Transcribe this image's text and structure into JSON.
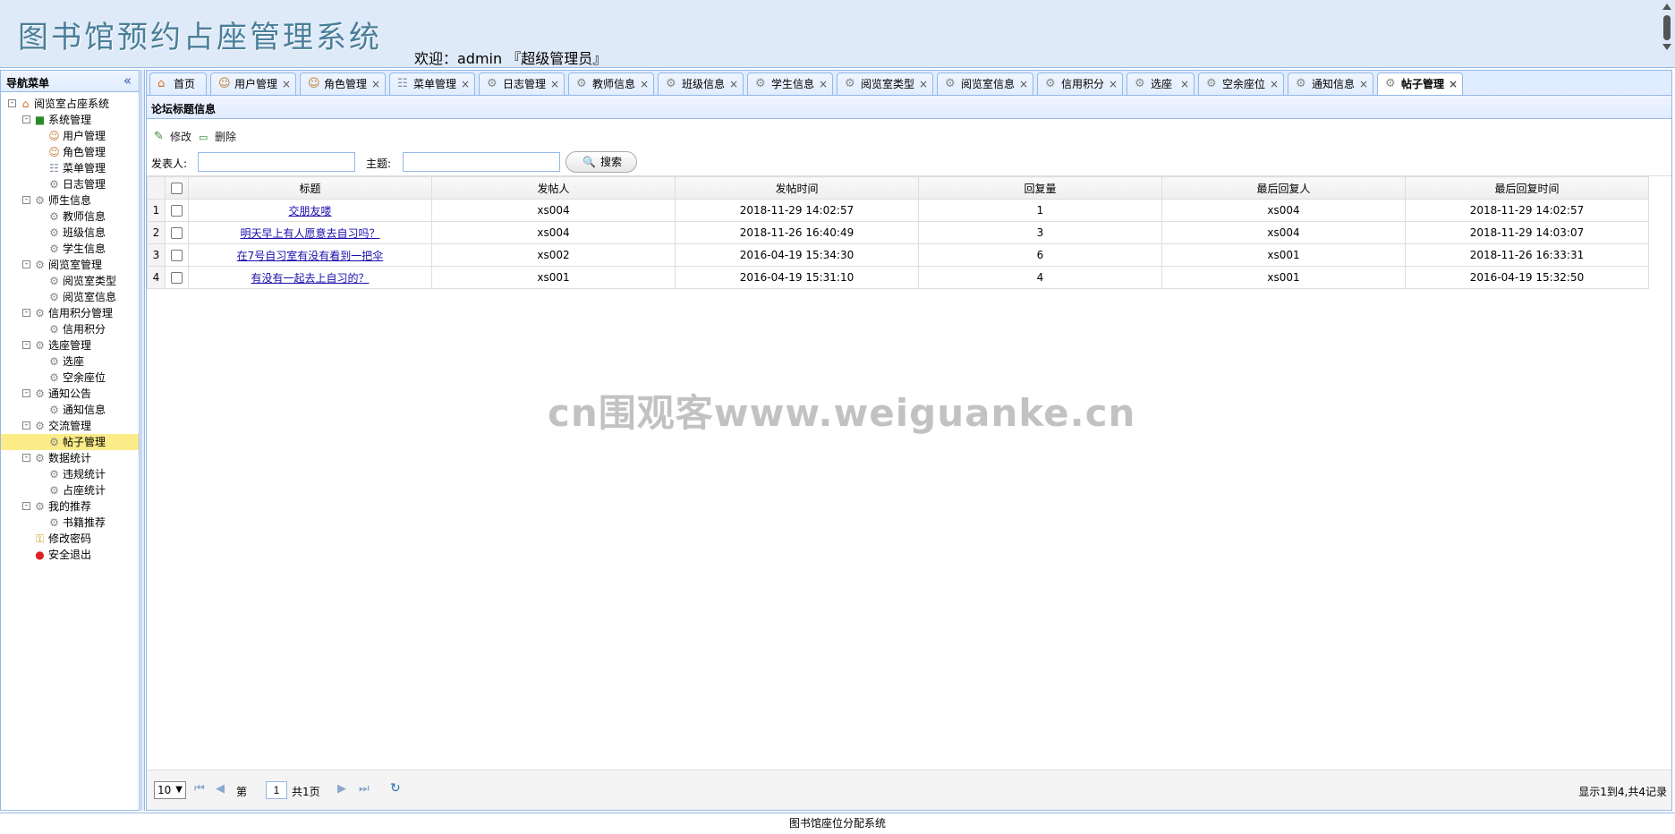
{
  "header": {
    "app_title": "图书馆预约占座管理系统",
    "welcome": "欢迎：admin 『超级管理员』"
  },
  "nav": {
    "title": "导航菜单",
    "collapse_icon": "double-chevron-left-icon",
    "tree": [
      {
        "label": "阅览室占座系统",
        "level": 0,
        "icon": "home-icon",
        "toggle": "-"
      },
      {
        "label": "系统管理",
        "level": 1,
        "icon": "system-icon",
        "toggle": "-"
      },
      {
        "label": "用户管理",
        "level": 2,
        "icon": "user-icon"
      },
      {
        "label": "角色管理",
        "level": 2,
        "icon": "user-icon"
      },
      {
        "label": "菜单管理",
        "level": 2,
        "icon": "menu-icon"
      },
      {
        "label": "日志管理",
        "level": 2,
        "icon": "gear-icon"
      },
      {
        "label": "师生信息",
        "level": 1,
        "icon": "gear-icon",
        "toggle": "-"
      },
      {
        "label": "教师信息",
        "level": 2,
        "icon": "gear-icon"
      },
      {
        "label": "班级信息",
        "level": 2,
        "icon": "gear-icon"
      },
      {
        "label": "学生信息",
        "level": 2,
        "icon": "gear-icon"
      },
      {
        "label": "阅览室管理",
        "level": 1,
        "icon": "gear-icon",
        "toggle": "-"
      },
      {
        "label": "阅览室类型",
        "level": 2,
        "icon": "gear-icon"
      },
      {
        "label": "阅览室信息",
        "level": 2,
        "icon": "gear-icon"
      },
      {
        "label": "信用积分管理",
        "level": 1,
        "icon": "gear-icon",
        "toggle": "-"
      },
      {
        "label": "信用积分",
        "level": 2,
        "icon": "gear-icon"
      },
      {
        "label": "选座管理",
        "level": 1,
        "icon": "gear-icon",
        "toggle": "-"
      },
      {
        "label": "选座",
        "level": 2,
        "icon": "gear-icon"
      },
      {
        "label": "空余座位",
        "level": 2,
        "icon": "gear-icon"
      },
      {
        "label": "通知公告",
        "level": 1,
        "icon": "gear-icon",
        "toggle": "-"
      },
      {
        "label": "通知信息",
        "level": 2,
        "icon": "gear-icon"
      },
      {
        "label": "交流管理",
        "level": 1,
        "icon": "gear-icon",
        "toggle": "-"
      },
      {
        "label": "帖子管理",
        "level": 2,
        "icon": "gear-icon",
        "selected": true
      },
      {
        "label": "数据统计",
        "level": 1,
        "icon": "gear-icon",
        "toggle": "-"
      },
      {
        "label": "违规统计",
        "level": 2,
        "icon": "gear-icon"
      },
      {
        "label": "占座统计",
        "level": 2,
        "icon": "gear-icon"
      },
      {
        "label": "我的推荐",
        "level": 1,
        "icon": "gear-icon",
        "toggle": "-"
      },
      {
        "label": "书籍推荐",
        "level": 2,
        "icon": "gear-icon"
      },
      {
        "label": "修改密码",
        "level": 1,
        "icon": "key-icon"
      },
      {
        "label": "安全退出",
        "level": 1,
        "icon": "exit-icon"
      }
    ]
  },
  "tabs": [
    {
      "label": "首页",
      "icon": "home-icon",
      "closable": false
    },
    {
      "label": "用户管理",
      "icon": "user-icon",
      "closable": true
    },
    {
      "label": "角色管理",
      "icon": "user-icon",
      "closable": true
    },
    {
      "label": "菜单管理",
      "icon": "menu-icon",
      "closable": true
    },
    {
      "label": "日志管理",
      "icon": "gear-icon",
      "closable": true
    },
    {
      "label": "教师信息",
      "icon": "gear-icon",
      "closable": true
    },
    {
      "label": "班级信息",
      "icon": "gear-icon",
      "closable": true
    },
    {
      "label": "学生信息",
      "icon": "gear-icon",
      "closable": true
    },
    {
      "label": "阅览室类型",
      "icon": "gear-icon",
      "closable": true
    },
    {
      "label": "阅览室信息",
      "icon": "gear-icon",
      "closable": true
    },
    {
      "label": "信用积分",
      "icon": "gear-icon",
      "closable": true
    },
    {
      "label": "选座",
      "icon": "gear-icon",
      "closable": true
    },
    {
      "label": "空余座位",
      "icon": "gear-icon",
      "closable": true
    },
    {
      "label": "通知信息",
      "icon": "gear-icon",
      "closable": true
    },
    {
      "label": "帖子管理",
      "icon": "gear-icon",
      "closable": true,
      "active": true
    }
  ],
  "panel": {
    "title": "论坛标题信息",
    "toolbar": {
      "edit_label": "修改",
      "delete_label": "删除"
    },
    "search": {
      "poster_label": "发表人:",
      "poster_value": "",
      "topic_label": "主题:",
      "topic_value": "",
      "button_label": "搜索"
    },
    "grid": {
      "columns": [
        "标题",
        "发帖人",
        "发帖时间",
        "回复量",
        "最后回复人",
        "最后回复时间"
      ],
      "rows": [
        {
          "n": "1",
          "title": "交朋友喽",
          "poster": "xs004",
          "time": "2018-11-29 14:02:57",
          "replies": "1",
          "last_replier": "xs004",
          "last_time": "2018-11-29 14:02:57"
        },
        {
          "n": "2",
          "title": "明天早上有人愿意去自习吗？",
          "poster": "xs004",
          "time": "2018-11-26 16:40:49",
          "replies": "3",
          "last_replier": "xs004",
          "last_time": "2018-11-29 14:03:07"
        },
        {
          "n": "3",
          "title": "在7号自习室有没有看到一把伞",
          "poster": "xs002",
          "time": "2016-04-19 15:34:30",
          "replies": "6",
          "last_replier": "xs001",
          "last_time": "2018-11-26 16:33:31"
        },
        {
          "n": "4",
          "title": "有没有一起去上自习的？",
          "poster": "xs001",
          "time": "2016-04-19 15:31:10",
          "replies": "4",
          "last_replier": "xs001",
          "last_time": "2016-04-19 15:32:50"
        }
      ]
    },
    "pager": {
      "page_size": "10",
      "page_prefix": "第",
      "page_value": "1",
      "page_total": "共1页",
      "info": "显示1到4,共4记录"
    }
  },
  "footer": {
    "text": "图书馆座位分配系统"
  },
  "watermark": "cn围观客www.weiguanke.cn",
  "colors": {
    "header_bg": "#dfeaf8",
    "border": "#95b8e7",
    "selected": "#fbec88",
    "link": "#1a0dab"
  }
}
